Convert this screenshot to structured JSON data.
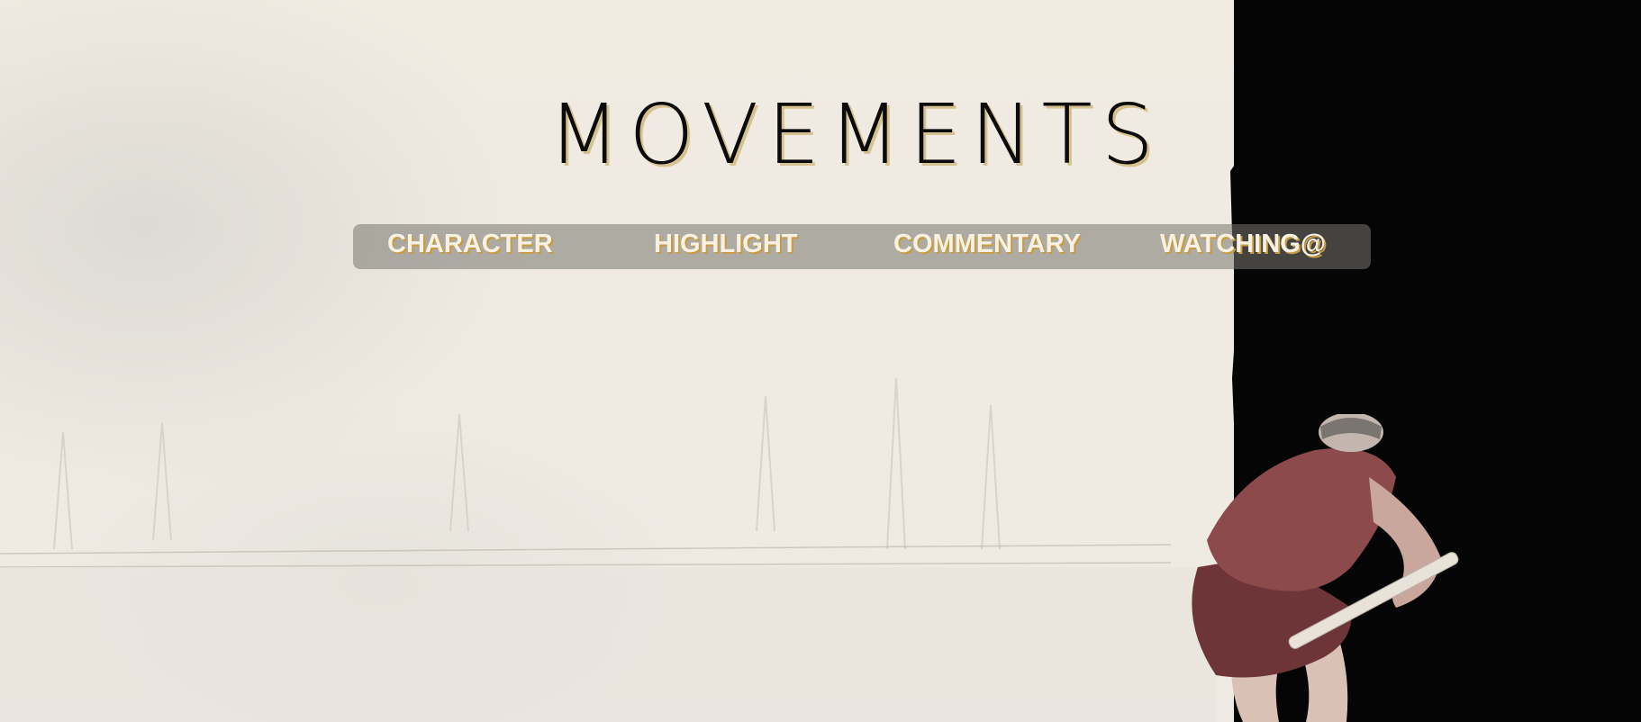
{
  "page": {
    "title": "MOVEMENTS"
  },
  "nav": {
    "items": [
      {
        "label": "CHARACTER"
      },
      {
        "label": "HIGHLIGHT"
      },
      {
        "label": "COMMENTARY"
      },
      {
        "label": "WATCHING@"
      }
    ]
  },
  "colors": {
    "background": "#f1ebe2",
    "dark_panel": "#050505",
    "title_text": "#0b0b0b",
    "title_shadow": "#d6c28e",
    "nav_text": "#f7f1e3",
    "nav_shadow": "#c79c44",
    "nav_bar": "#78766f",
    "figure_shirt": "#8c4a4c",
    "figure_shorts": "#6e3538"
  },
  "icons": {
    "illustration": "hunched-figure-with-stick"
  }
}
